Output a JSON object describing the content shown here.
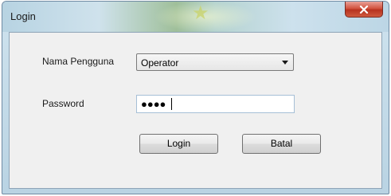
{
  "window": {
    "title": "Login",
    "close_icon": "close-x-icon"
  },
  "form": {
    "username_label": "Nama Pengguna",
    "username_value": "Operator",
    "password_label": "Password",
    "password_masked": "●●●●"
  },
  "buttons": {
    "login_label": "Login",
    "cancel_label": "Batal"
  },
  "colors": {
    "close_button": "#c9452f",
    "client_background": "#f0f0f0",
    "frame": "#b9d3e3"
  }
}
